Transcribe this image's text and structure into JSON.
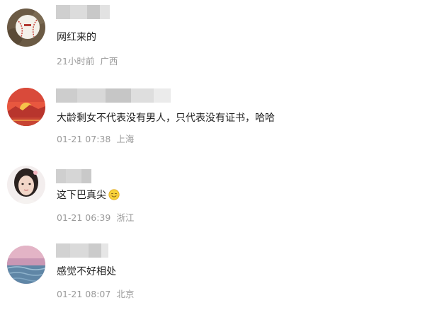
{
  "comments": [
    {
      "content": "网红来的",
      "time": "21小时前",
      "location": "广西"
    },
    {
      "content": "大龄剩女不代表没有男人，只代表没有证书，哈哈",
      "time": "01-21 07:38",
      "location": "上海"
    },
    {
      "content": "这下巴真尖",
      "emoji": "smiling-emoji",
      "time": "01-21 06:39",
      "location": "浙江"
    },
    {
      "content": "感觉不好相处",
      "time": "01-21 08:07",
      "location": "北京"
    }
  ]
}
